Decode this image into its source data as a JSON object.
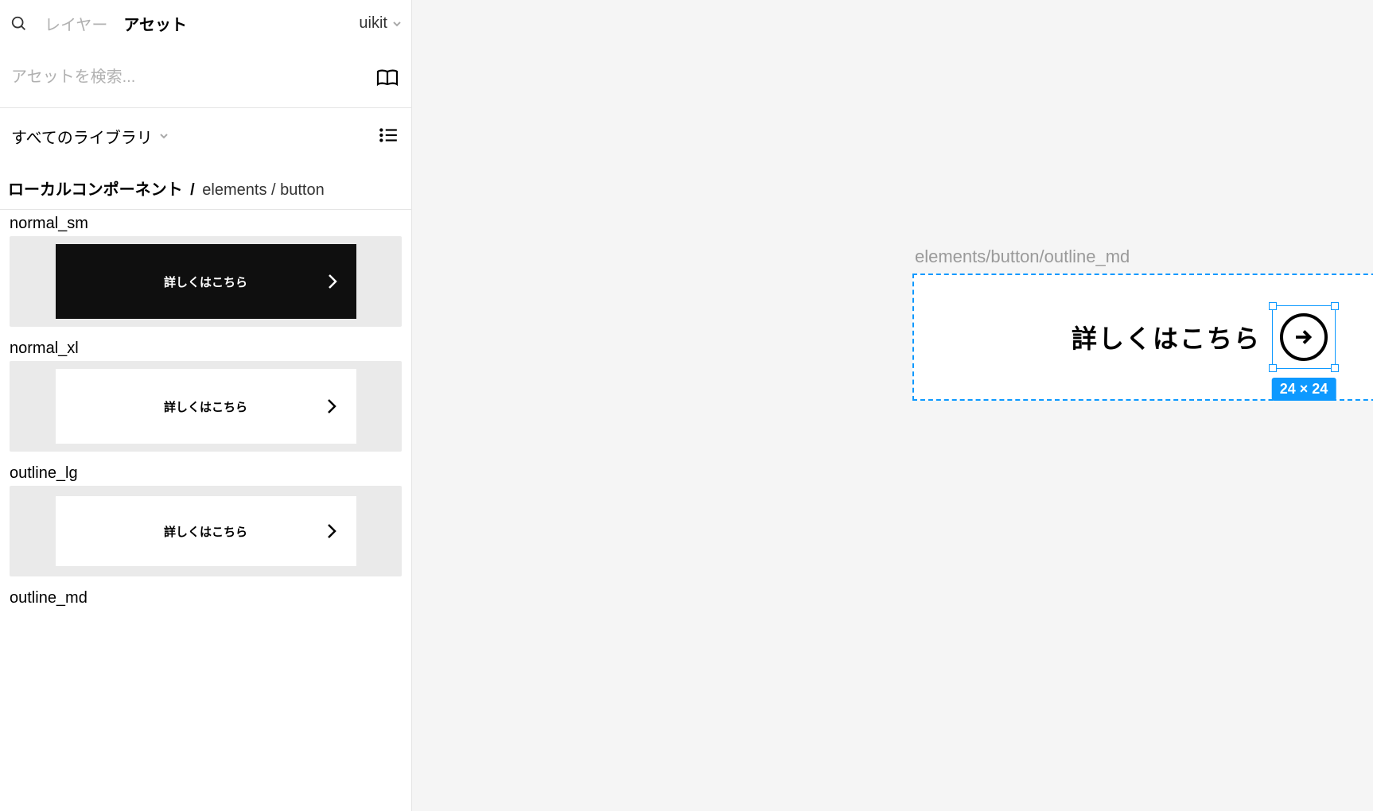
{
  "topbar": {
    "tab_layers": "レイヤー",
    "tab_assets": "アセット",
    "doc_name": "uikit"
  },
  "search": {
    "placeholder": "アセットを検索..."
  },
  "library": {
    "label": "すべてのライブラリ"
  },
  "breadcrumb": {
    "local": "ローカルコンポーネント",
    "slash": "/",
    "path": " elements / button"
  },
  "components": {
    "item0_label": "normal_sm",
    "item0_text": "詳しくはこちら",
    "item1_label": "normal_xl",
    "item1_text": "詳しくはこちら",
    "item2_label": "outline_lg",
    "item2_text": "詳しくはこちら",
    "item3_label": "outline_md"
  },
  "canvas": {
    "frame_label": "elements/button/outline_md",
    "button_text": "詳しくはこちら",
    "dim_badge": "24 × 24"
  }
}
